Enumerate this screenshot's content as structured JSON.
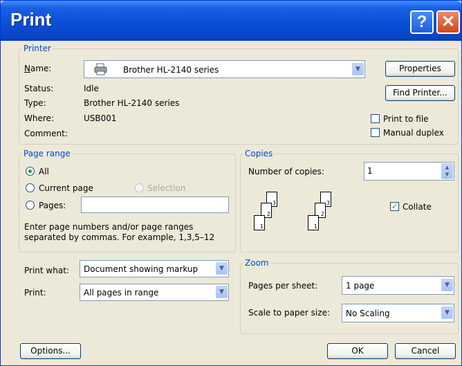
{
  "window": {
    "title": "Print",
    "help_glyph": "?",
    "close_glyph": "✕"
  },
  "printer": {
    "legend": "Printer",
    "name_label": "Name:",
    "name_value": "Brother HL-2140 series",
    "status_label": "Status:",
    "status_value": "Idle",
    "type_label": "Type:",
    "type_value": "Brother HL-2140 series",
    "where_label": "Where:",
    "where_value": "USB001",
    "comment_label": "Comment:",
    "comment_value": "",
    "properties_button": "Properties",
    "find_printer_button": "Find Printer...",
    "print_to_file": {
      "label": "Print to file",
      "checked": false
    },
    "manual_duplex": {
      "label": "Manual duplex",
      "checked": false
    }
  },
  "page_range": {
    "legend": "Page range",
    "all_label": "All",
    "current_page_label": "Current page",
    "selection_label": "Selection",
    "pages_label": "Pages:",
    "pages_value": "",
    "selected": "all",
    "hint_line1": "Enter page numbers and/or page ranges",
    "hint_line2": "separated by commas.  For example, 1,3,5–12"
  },
  "copies": {
    "legend": "Copies",
    "number_label": "Number of copies:",
    "number_value": "1",
    "collate": {
      "label": "Collate",
      "checked": true
    },
    "page_numbers": [
      "1",
      "2",
      "3"
    ]
  },
  "print_what": {
    "label": "Print what:",
    "value": "Document showing markup"
  },
  "print": {
    "label": "Print:",
    "value": "All pages in range"
  },
  "zoom": {
    "legend": "Zoom",
    "pages_per_sheet_label": "Pages per sheet:",
    "pages_per_sheet_value": "1 page",
    "scale_label": "Scale to paper size:",
    "scale_value": "No Scaling"
  },
  "buttons": {
    "options": "Options...",
    "ok": "OK",
    "cancel": "Cancel"
  },
  "icons": {
    "dropdown_arrow": "▼",
    "spin_up": "▲",
    "spin_down": "▼",
    "checkmark": "✓"
  },
  "colors": {
    "titlebar": "#0b4fd8",
    "legend_text": "#0046d5",
    "dialog_bg": "#ece9d8"
  }
}
